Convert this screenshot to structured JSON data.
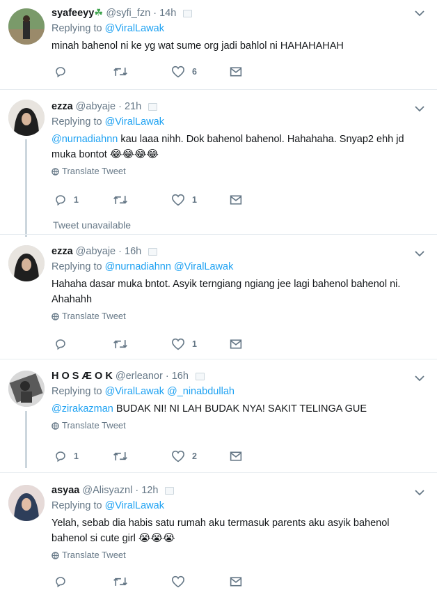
{
  "tweets": [
    {
      "name": "syafeeyy",
      "name_emoji": "☘",
      "handle": "@syfi_fzn",
      "time": "14h",
      "replying_label": "Replying to",
      "replying_to": "@ViralLawak",
      "text": "minah bahenol ni ke yg wat sume org jadi bahlol ni HAHAHAHAH",
      "reply_count": "",
      "like_count": "6"
    },
    {
      "name": "ezza",
      "handle": "@abyaje",
      "time": "21h",
      "replying_label": "Replying to",
      "replying_to": "@ViralLawak",
      "mention": "@nurnadiahnn",
      "text_line1": " kau laaa nihh. Dok bahenol bahenol. Hahahaha. Snyap2 ehh jd",
      "text_line2": "muka bontot ",
      "emojis": "😂😂😂😂",
      "translate": "Translate Tweet",
      "reply_count": "1",
      "like_count": "1"
    },
    {
      "unavailable": "Tweet unavailable"
    },
    {
      "name": "ezza",
      "handle": "@abyaje",
      "time": "16h",
      "replying_label": "Replying to",
      "replying_to": "@nurnadiahnn @ViralLawak",
      "text_line1": "Hahaha dasar muka bntot. Asyik terngiang ngiang jee lagi bahenol bahenol ni.",
      "text_line2": "Ahahahh",
      "translate": "Translate Tweet",
      "reply_count": "",
      "like_count": "1"
    },
    {
      "name": "H O S Æ O K",
      "handle": "@erleanor",
      "time": "16h",
      "replying_label": "Replying to",
      "replying_to": "@ViralLawak @_ninabdullah",
      "mention": "@zirakazman",
      "text": " BUDAK NI! NI LAH BUDAK NYA! SAKIT TELINGA GUE",
      "translate": "Translate Tweet",
      "reply_count": "1",
      "like_count": "2"
    },
    {
      "name": "asyaa",
      "handle": "@Alisyaznl",
      "time": "12h",
      "replying_label": "Replying to",
      "replying_to": "@ViralLawak",
      "text_line1": "Yelah, sebab dia habis satu rumah aku termasuk parents aku asyik bahenol",
      "text_line2": "bahenol si cute girl ",
      "emojis": "😭😭😭",
      "translate": "Translate Tweet",
      "reply_count": "",
      "like_count": ""
    }
  ],
  "dot": "·",
  "colors": {
    "link": "#1da1f2",
    "muted": "#657786",
    "thread_line": "#ccd6dd"
  },
  "icons": [
    "reply-icon",
    "retweet-icon",
    "like-icon",
    "dm-icon",
    "chevron-down-icon",
    "globe-icon",
    "embed-icon"
  ]
}
